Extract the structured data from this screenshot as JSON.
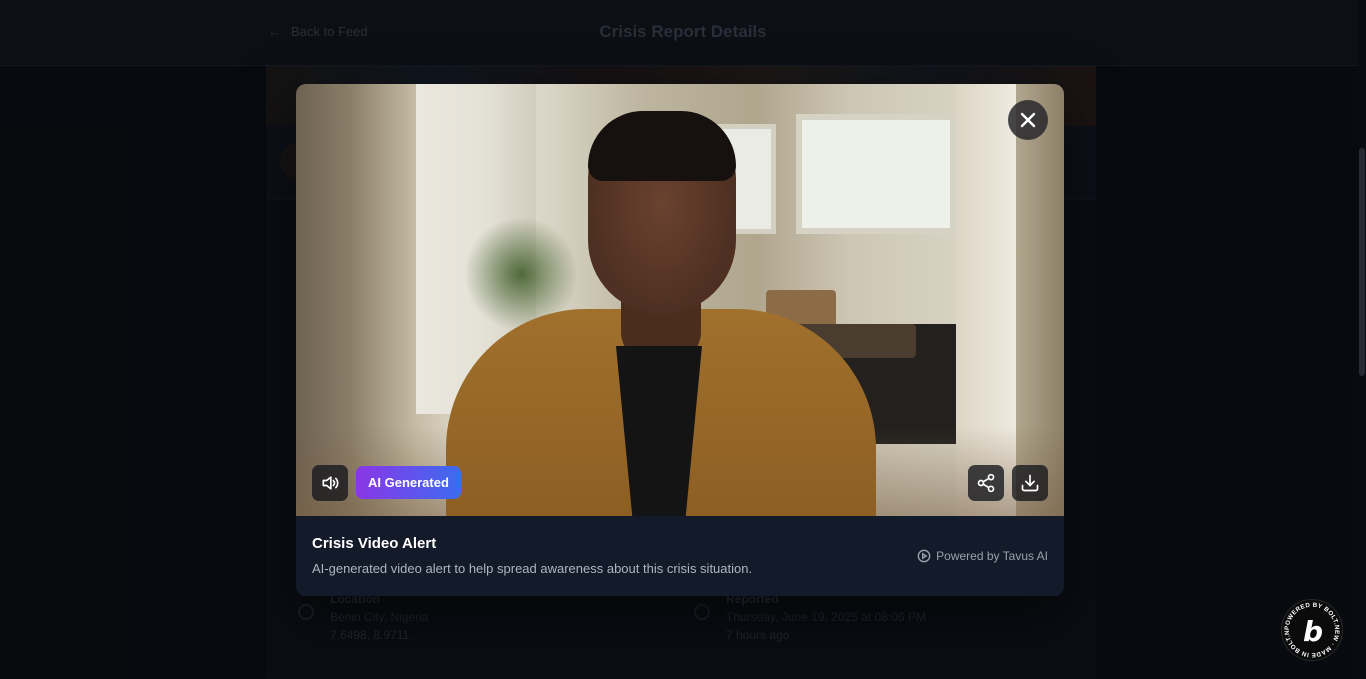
{
  "background": {
    "back_label": "Back to Feed",
    "page_title": "Crisis Report Details",
    "location_label": "Location",
    "location_value": "Benin City, Nigeria",
    "location_coords": "7.6498, 8.9711",
    "time_label": "Reported",
    "time_value": "Thursday, June 19, 2025 at 08:06 PM",
    "time_ago": "7 hours ago"
  },
  "modal": {
    "badge_label": "AI Generated",
    "title": "Crisis Video Alert",
    "description": "AI-generated video alert to help spread awareness about this crisis situation.",
    "powered_by": "Powered by Tavus AI",
    "icons": {
      "mute": "speaker-icon",
      "share": "share-icon",
      "download": "download-icon",
      "close": "close-icon",
      "powered": "play-circle-icon"
    }
  },
  "branding": {
    "bolt_ring_text": "POWERED BY BOLT.NEW · MADE IN BOLT.NEW ·",
    "bolt_letter": "b"
  },
  "colors": {
    "badge_gradient_start": "#8b36e6",
    "badge_gradient_end": "#3b6cf0",
    "modal_footer": "#131a2a"
  }
}
